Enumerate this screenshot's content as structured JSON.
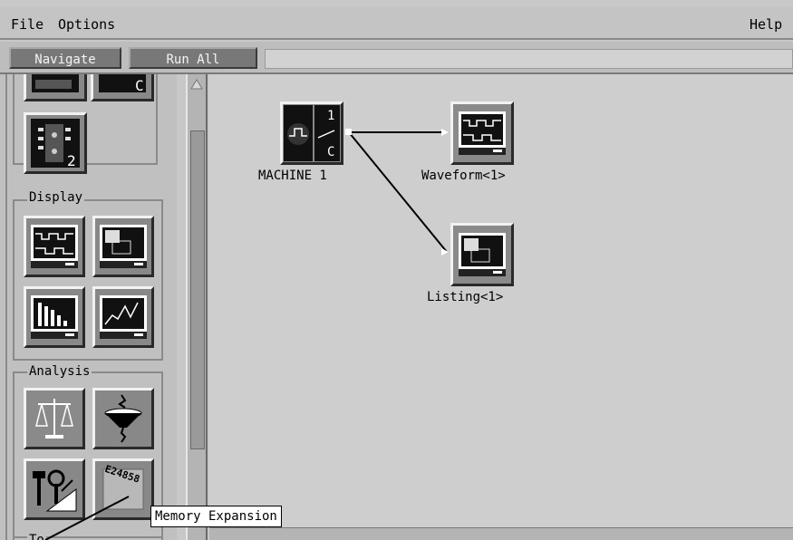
{
  "menubar": {
    "file": "File",
    "options": "Options",
    "help": "Help"
  },
  "toolbar": {
    "navigate": "Navigate",
    "run_all": "Run All"
  },
  "palette": {
    "top_icon_badge": "C",
    "machine_icon_badge": "2",
    "display_label": "Display",
    "analysis_label": "Analysis",
    "memory_icon_text": "E24858",
    "partial_group_label": "To"
  },
  "canvas": {
    "machine_label": "MACHINE 1",
    "machine_badge_top": "1",
    "machine_badge_bottom": "C",
    "waveform_label": "Waveform<1>",
    "listing_label": "Listing<1>"
  },
  "tooltip": {
    "text": "Memory Expansion"
  }
}
